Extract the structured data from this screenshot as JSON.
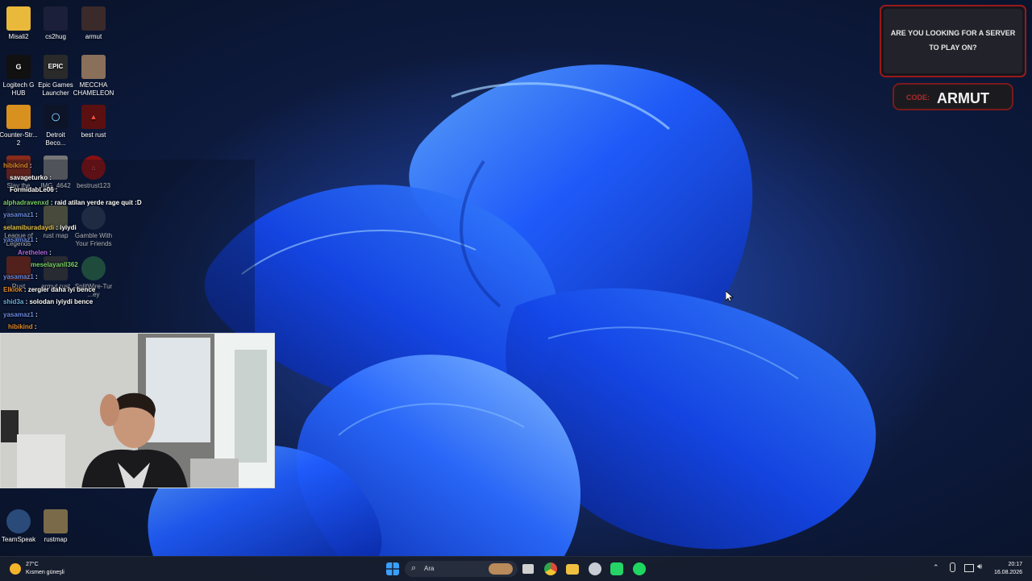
{
  "desktop_icons": [
    {
      "label_lines": [
        "Misali2"
      ],
      "icon": "folder-icon",
      "color": "#e8b93a",
      "glyph": ""
    },
    {
      "label_lines": [
        "cs2hug"
      ],
      "icon": "cs2hug-icon",
      "color": "#1b1f3a",
      "glyph": ""
    },
    {
      "label_lines": [
        "armut"
      ],
      "icon": "armut-avatar-icon",
      "color": "#3a2a2a",
      "glyph": ""
    },
    {
      "label_lines": [
        "Logitech G",
        "HUB"
      ],
      "icon": "logitech-g-icon",
      "color": "#111111",
      "glyph": "G"
    },
    {
      "label_lines": [
        "Epic Games",
        "Launcher"
      ],
      "icon": "epic-games-icon",
      "color": "#2a2a2a",
      "glyph": "EPIC"
    },
    {
      "label_lines": [
        "MECCHA",
        "CHAMELEON"
      ],
      "icon": "meccha-chameleon-icon",
      "color": "#8a6f5a",
      "glyph": ""
    },
    {
      "label_lines": [
        "Counter-Str...",
        "2"
      ],
      "icon": "counter-strike-icon",
      "color": "#d8901e",
      "glyph": ""
    },
    {
      "label_lines": [
        "Detroit",
        "Beco..."
      ],
      "icon": "detroit-become-icon",
      "color": "#0d1428",
      "glyph": "○"
    },
    {
      "label_lines": [
        "best rust"
      ],
      "icon": "best-rust-icon",
      "color": "#5a1010",
      "glyph": "▲"
    },
    {
      "label_lines": [
        "Slay the"
      ],
      "icon": "slay-the-spire-icon",
      "color": "#8a2a1a",
      "glyph": ""
    },
    {
      "label_lines": [
        "IMG_4642"
      ],
      "icon": "image-file-icon",
      "color": "#777777",
      "glyph": ""
    },
    {
      "label_lines": [
        "bestrust123"
      ],
      "icon": "bestrust123-icon",
      "color": "#8a1010",
      "glyph": "⌂"
    },
    {
      "label_lines": [
        "League of",
        "Legends"
      ],
      "icon": "league-of-legends-icon",
      "color": "#1a2a44",
      "glyph": ""
    },
    {
      "label_lines": [
        "rust map"
      ],
      "icon": "rust-map-icon",
      "color": "#6a6a4a",
      "glyph": ""
    },
    {
      "label_lines": [
        "Gamble With",
        "Your Friends"
      ],
      "icon": "gamble-with-friends-icon",
      "color": "#2a3a55",
      "glyph": ""
    },
    {
      "label_lines": [
        "Rust"
      ],
      "icon": "rust-icon",
      "color": "#7a2a1a",
      "glyph": ""
    },
    {
      "label_lines": [
        "armut rust"
      ],
      "icon": "armut-rust-icon",
      "color": "#3a3a3a",
      "glyph": ""
    },
    {
      "label_lines": [
        "SplitWire-Tur",
        "...ey"
      ],
      "icon": "splitwire-icon",
      "color": "#2a6a4a",
      "glyph": ""
    },
    {
      "label_lines": [
        "TeamSpeak"
      ],
      "icon": "teamspeak-icon",
      "color": "#2a4a7a",
      "glyph": ""
    },
    {
      "label_lines": [
        "rustmap"
      ],
      "icon": "rustmap-icon",
      "color": "#7a6a4a",
      "glyph": ""
    }
  ],
  "chat_messages": [
    {
      "user": "hibikind",
      "text": "",
      "color": "#e08a2a"
    },
    {
      "user": "savageturko",
      "text": "",
      "color": "#ffffff"
    },
    {
      "user": "FormidabLe06",
      "text": "",
      "color": "#ffffff"
    },
    {
      "user": "alphadravenxd",
      "text": "raid atilan yerde rage quit :D",
      "color": "#7ad36a"
    },
    {
      "user": "yasamaz1",
      "text": "",
      "color": "#6a8ae0"
    },
    {
      "user": "selamiburadaydi",
      "text": "iyiydi",
      "color": "#e0c04a"
    },
    {
      "user": "yasamaz1",
      "text": "",
      "color": "#6a8ae0"
    },
    {
      "user": "Arethelen",
      "text": "",
      "color": "#b06ae0"
    },
    {
      "user": "meselayanll362",
      "text": "",
      "color": "#7ad36a"
    },
    {
      "user": "yasamaz1",
      "text": "",
      "color": "#6a8ae0"
    },
    {
      "user": "Elkiok",
      "text": "zergler daha iyi bence",
      "color": "#e08a2a"
    },
    {
      "user": "shid3a",
      "text": "solodan iyiydi bence",
      "color": "#6ab0e0"
    },
    {
      "user": "yasamaz1",
      "text": "",
      "color": "#6a8ae0"
    },
    {
      "user": "hibikind",
      "text": "",
      "color": "#e08a2a"
    }
  ],
  "ad": {
    "headline_line1": "ARE YOU LOOKING FOR A SERVER",
    "headline_line2": "TO PLAY ON?",
    "code_label": "CODE:",
    "code_value": "ARMUT"
  },
  "taskbar": {
    "weather_temp": "27°C",
    "weather_desc": "Kısmen güneşli",
    "search_placeholder": "Ara",
    "time": "20:17",
    "date": "16.08.2026",
    "apps": [
      {
        "icon": "task-view-icon",
        "color": "#d0d0d0"
      },
      {
        "icon": "chrome-icon",
        "color": "#e04a3a"
      },
      {
        "icon": "file-explorer-icon",
        "color": "#f0c040"
      },
      {
        "icon": "steam-icon",
        "color": "#c8ccd4"
      },
      {
        "icon": "whatsapp-icon",
        "color": "#25d366"
      },
      {
        "icon": "spotify-icon",
        "color": "#1ed760"
      }
    ]
  }
}
